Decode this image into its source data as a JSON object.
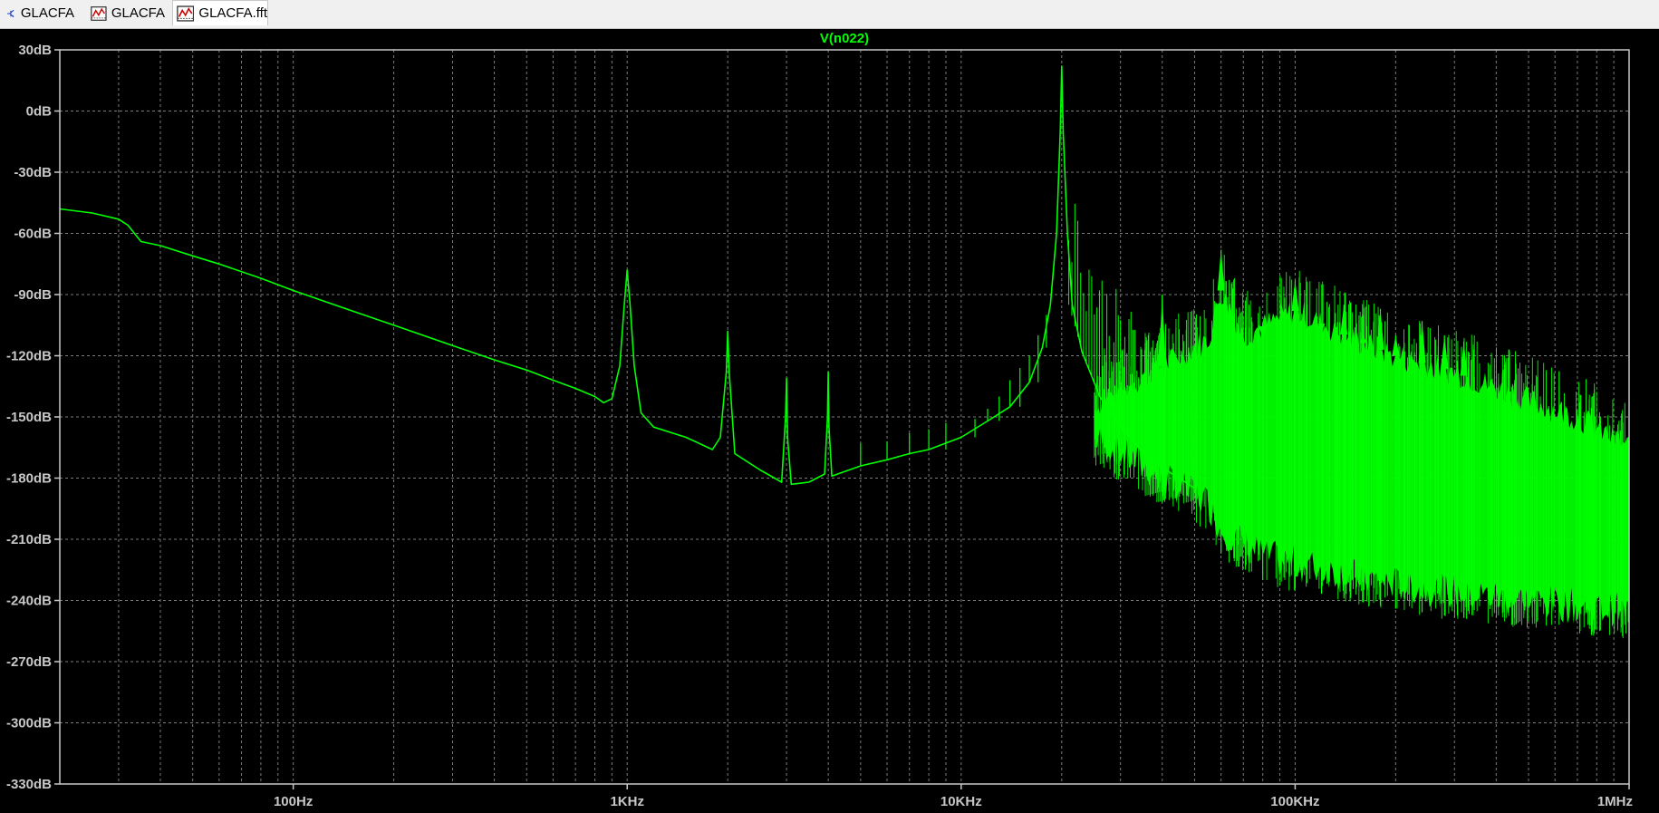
{
  "tabs": [
    {
      "label": "GLACFA",
      "icon": "schematic-icon"
    },
    {
      "label": "GLACFA",
      "icon": "waveform-icon"
    },
    {
      "label": "GLACFA.fft",
      "icon": "waveform-icon"
    }
  ],
  "active_tab": 2,
  "colors": {
    "background": "#000000",
    "trace": "#00ff00",
    "grid": "#7a7a7a",
    "frame": "#c8c8c8",
    "axis_text": "#c8c8c8"
  },
  "chart_data": {
    "type": "line",
    "title": "V(n022)",
    "x_scale": "log",
    "xlim_hz": [
      20,
      1000000
    ],
    "ylim_db": [
      -330,
      30
    ],
    "x_ticks": [
      {
        "value": 100,
        "label": "100Hz"
      },
      {
        "value": 1000,
        "label": "1KHz"
      },
      {
        "value": 10000,
        "label": "10KHz"
      },
      {
        "value": 100000,
        "label": "100KHz"
      },
      {
        "value": 1000000,
        "label": "1MHz"
      }
    ],
    "y_ticks": [
      {
        "value": 30,
        "label": "30dB"
      },
      {
        "value": 0,
        "label": "0dB"
      },
      {
        "value": -30,
        "label": "-30dB"
      },
      {
        "value": -60,
        "label": "-60dB"
      },
      {
        "value": -90,
        "label": "-90dB"
      },
      {
        "value": -120,
        "label": "-120dB"
      },
      {
        "value": -150,
        "label": "-150dB"
      },
      {
        "value": -180,
        "label": "-180dB"
      },
      {
        "value": -210,
        "label": "-210dB"
      },
      {
        "value": -240,
        "label": "-240dB"
      },
      {
        "value": -270,
        "label": "-270dB"
      },
      {
        "value": -300,
        "label": "-300dB"
      },
      {
        "value": -330,
        "label": "-330dB"
      }
    ],
    "grid": true,
    "series": [
      {
        "name": "V(n022)",
        "color": "#00ff00",
        "points": [
          [
            20,
            -48
          ],
          [
            25,
            -50
          ],
          [
            30,
            -53
          ],
          [
            32,
            -56
          ],
          [
            35,
            -64
          ],
          [
            40,
            -66
          ],
          [
            50,
            -71
          ],
          [
            60,
            -75
          ],
          [
            80,
            -82
          ],
          [
            100,
            -88
          ],
          [
            150,
            -98
          ],
          [
            200,
            -105
          ],
          [
            300,
            -115
          ],
          [
            400,
            -122
          ],
          [
            500,
            -127
          ],
          [
            600,
            -132
          ],
          [
            700,
            -136
          ],
          [
            800,
            -140
          ],
          [
            850,
            -143
          ],
          [
            900,
            -141
          ],
          [
            950,
            -125
          ],
          [
            980,
            -95
          ],
          [
            1000,
            -78
          ],
          [
            1020,
            -95
          ],
          [
            1050,
            -125
          ],
          [
            1100,
            -148
          ],
          [
            1200,
            -155
          ],
          [
            1500,
            -160
          ],
          [
            1800,
            -166
          ],
          [
            1900,
            -160
          ],
          [
            1980,
            -128
          ],
          [
            2000,
            -108
          ],
          [
            2020,
            -128
          ],
          [
            2100,
            -168
          ],
          [
            2500,
            -176
          ],
          [
            2900,
            -182
          ],
          [
            2980,
            -150
          ],
          [
            3000,
            -131
          ],
          [
            3020,
            -160
          ],
          [
            3100,
            -183
          ],
          [
            3500,
            -182
          ],
          [
            3900,
            -178
          ],
          [
            3980,
            -150
          ],
          [
            4000,
            -128
          ],
          [
            4020,
            -155
          ],
          [
            4100,
            -179
          ],
          [
            5000,
            -174
          ],
          [
            6000,
            -171
          ],
          [
            7000,
            -168
          ],
          [
            8000,
            -166
          ],
          [
            10000,
            -160
          ],
          [
            12000,
            -152
          ],
          [
            14000,
            -145
          ],
          [
            16000,
            -133
          ],
          [
            17500,
            -116
          ],
          [
            18500,
            -95
          ],
          [
            19300,
            -60
          ],
          [
            19800,
            -10
          ],
          [
            20000,
            22
          ],
          [
            20200,
            -10
          ],
          [
            20800,
            -60
          ],
          [
            21500,
            -95
          ],
          [
            23000,
            -118
          ],
          [
            26000,
            -140
          ],
          [
            30000,
            -155
          ],
          [
            35000,
            -167
          ],
          [
            40000,
            -175
          ],
          [
            45000,
            -180
          ],
          [
            50000,
            -185
          ]
        ],
        "noise_band": {
          "start_hz": 25000,
          "end_hz": 1000000,
          "upper_db": [
            [
              25000,
              -145
            ],
            [
              40000,
              -125
            ],
            [
              55000,
              -112
            ],
            [
              60000,
              -88
            ],
            [
              70000,
              -110
            ],
            [
              100000,
              -98
            ],
            [
              150000,
              -112
            ],
            [
              200000,
              -120
            ],
            [
              300000,
              -128
            ],
            [
              500000,
              -142
            ],
            [
              700000,
              -150
            ],
            [
              1000000,
              -165
            ]
          ],
          "lower_db": [
            [
              25000,
              -160
            ],
            [
              40000,
              -180
            ],
            [
              55000,
              -192
            ],
            [
              60000,
              -205
            ],
            [
              80000,
              -218
            ],
            [
              100000,
              -222
            ],
            [
              150000,
              -228
            ],
            [
              200000,
              -232
            ],
            [
              300000,
              -236
            ],
            [
              500000,
              -240
            ],
            [
              700000,
              -243
            ],
            [
              1000000,
              -245
            ]
          ],
          "peaks": [
            {
              "hz": 40000,
              "db": -90
            },
            {
              "hz": 60000,
              "db": -68
            },
            {
              "hz": 80000,
              "db": -112
            },
            {
              "hz": 100000,
              "db": -83
            },
            {
              "hz": 120000,
              "db": -108
            },
            {
              "hz": 140000,
              "db": -95
            },
            {
              "hz": 160000,
              "db": -110
            },
            {
              "hz": 180000,
              "db": -97
            },
            {
              "hz": 200000,
              "db": -110
            },
            {
              "hz": 240000,
              "db": -103
            },
            {
              "hz": 280000,
              "db": -110
            },
            {
              "hz": 320000,
              "db": -113
            }
          ]
        }
      }
    ]
  }
}
